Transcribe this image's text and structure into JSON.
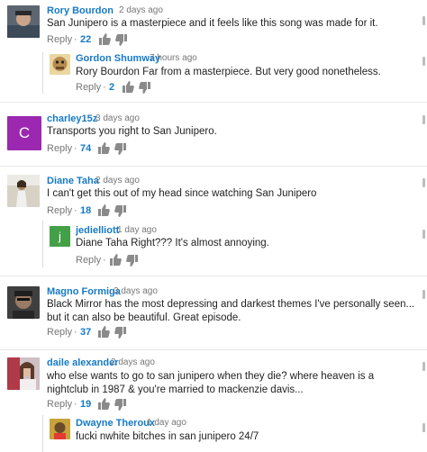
{
  "comments": [
    {
      "author": "Rory Bourdon",
      "time": "2 days ago",
      "text": "San Junipero is a masterpiece and it feels like this song was made for it.",
      "reply_label": "Reply",
      "likes": "22"
    },
    {
      "author": "Gordon Shumway",
      "time": "7 hours ago",
      "text": "Rory Bourdon Far from a masterpiece. But very good nonetheless.",
      "reply_label": "Reply",
      "likes": "2"
    },
    {
      "author": "charley15z",
      "time": "3 days ago",
      "text": "Transports you right to San Junipero.",
      "reply_label": "Reply",
      "likes": "74",
      "avatar_letter": "C",
      "avatar_color": "#9c27b0"
    },
    {
      "author": "Diane Taha",
      "time": "2 days ago",
      "text": "I can't get this out of my head since watching San Junipero",
      "reply_label": "Reply",
      "likes": "18"
    },
    {
      "author": "jedielliott",
      "time": "1 day ago",
      "text": "Diane Taha Right??? It's almost annoying.",
      "reply_label": "Reply",
      "avatar_letter": "j",
      "avatar_color": "#43a047"
    },
    {
      "author": "Magno Formiga",
      "time": "3 days ago",
      "text": "Black Mirror has the most depressing and darkest themes I've personally seen... but it can also be beautiful. Great episode.",
      "reply_label": "Reply",
      "likes": "37"
    },
    {
      "author": "daile alexander",
      "time": "2 days ago",
      "text": "who else wants to go to san junipero when they die? where heaven is a nightclub in 1987 & you're married to mackenzie davis...",
      "reply_label": "Reply",
      "likes": "19"
    },
    {
      "author": "Dwayne Theroux",
      "time": "1 day ago",
      "text": "fucki nwhite bitches in san junipero 24/7"
    }
  ]
}
